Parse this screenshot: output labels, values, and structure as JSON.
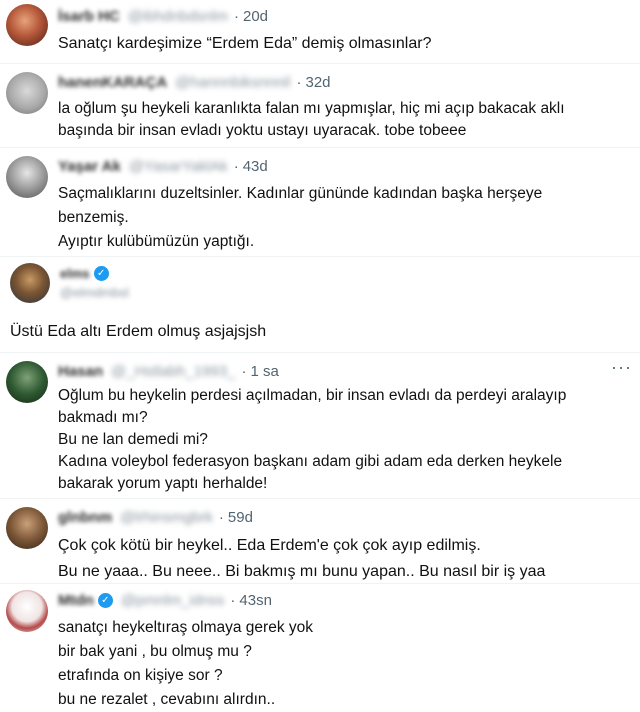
{
  "posts": [
    {
      "name": "İsarb HC",
      "handle": "@ibhdnbdsnlm",
      "time": "20d",
      "lines": [
        "Sanatçı kardeşimize “Erdem Eda” demiş olmasınlar?"
      ]
    },
    {
      "name": "hanenKARAÇA",
      "handle": "@hannnbiksnnnil",
      "time": "32d",
      "lines": [
        "la oğlum şu heykeli karanlıkta falan mı yapmışlar, hiç mi açıp bakacak aklı",
        "başında bir insan evladı yoktu ustayı uyaracak. tobe tobeee"
      ]
    },
    {
      "name": "Yaşar Ak",
      "handle": "@YasarYaklAk",
      "time": "43d",
      "lines": [
        "Saçmalıklarını duzeltsinler. Kadınlar gününde kadından başka herşeye",
        "benzemiş.",
        "Ayıptır kulübümüzün yaptığı."
      ]
    },
    {
      "name": "elms",
      "handle": "@elmdmbsl",
      "time": "",
      "lines": []
    },
    {
      "name": "",
      "handle": "",
      "time": "",
      "lines": [
        "Üstü Eda altı Erdem olmuş asjajsjsh"
      ]
    },
    {
      "name": "Hasan",
      "handle": "@_Hstlabh_1993_",
      "time": "1 sa",
      "more": "···",
      "lines": [
        "Oğlum bu heykelin perdesi açılmadan, bir insan evladı da perdeyi aralayıp",
        "bakmadı mı?",
        "Bu ne lan demedi mi?",
        "Kadına voleybol federasyon başkanı adam gibi adam eda derken heykele",
        "bakarak yorum yaptı herhalde!"
      ]
    },
    {
      "name": "glnbnm",
      "handle": "@lrhinsmgbrk",
      "time": "59d",
      "lines": [
        "Çok çok kötü bir heykel.. Eda Erdem'e çok çok ayıp edilmiş.",
        "Bu ne yaaa.. Bu neee.. Bi bakmış mı bunu yapan.. Bu nasıl bir iş yaa"
      ]
    },
    {
      "name": "Mtdn",
      "handle": "@pmnlm_idnss",
      "time": "43sn",
      "lines": [
        "sanatçı heykeltıraş olmaya gerek yok",
        "bir bak yani , bu olmuş mu ?",
        "etrafında on kişiye sor ?",
        "bu ne rezalet , cevabını alırdın.."
      ]
    }
  ],
  "colors": {
    "accent": "#1d9bf0",
    "text": "#0f1419",
    "muted": "#536471"
  }
}
